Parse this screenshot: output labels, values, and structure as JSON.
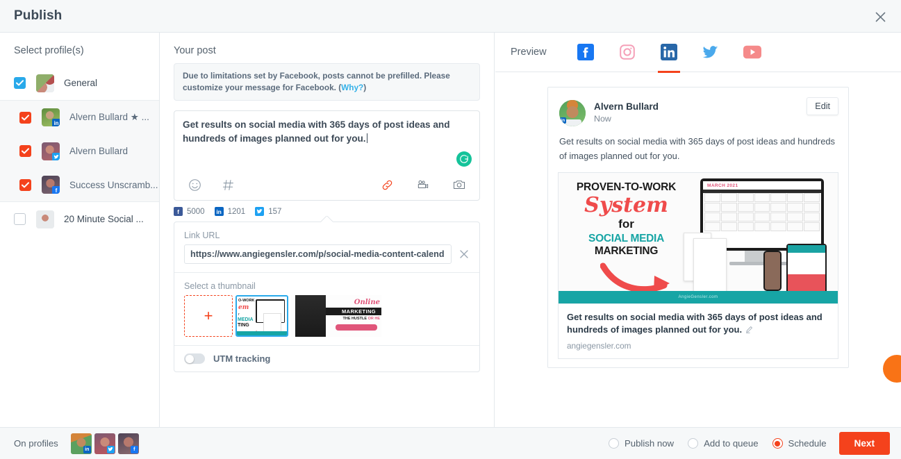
{
  "titlebar": {
    "title": "Publish",
    "close_icon": "close-icon"
  },
  "sidebar": {
    "heading": "Select profile(s)",
    "items": [
      {
        "label": "General",
        "checked": true,
        "accent": "#29a9ea",
        "network": "group",
        "star": false
      },
      {
        "label": "Alvern Bullard ★ ...",
        "checked": true,
        "accent": "#f4421c",
        "network": "linkedin",
        "badge": "in"
      },
      {
        "label": "Alvern Bullard",
        "checked": true,
        "accent": "#f4421c",
        "network": "twitter",
        "badge": "t"
      },
      {
        "label": "Success Unscramb...",
        "checked": true,
        "accent": "#f4421c",
        "network": "facebook",
        "badge": "f"
      },
      {
        "label": "20 Minute Social ...",
        "checked": false,
        "accent": "#ffffff",
        "network": "none",
        "badge": ""
      }
    ]
  },
  "composer": {
    "heading": "Your post",
    "notice_text": "Due to limitations set by Facebook, posts cannot be prefilled. Please customize your message for Facebook. (",
    "notice_link": "Why?",
    "notice_tail": ")",
    "post_text": "Get results on social media with 365 days of post ideas and hundreds of images planned out for you.",
    "grammarly_icon": "grammarly-icon",
    "toolbar_icons": [
      "emoji-icon",
      "hashtag-icon",
      "link-icon",
      "video-icon",
      "photo-icon"
    ],
    "counters": [
      {
        "network": "facebook",
        "value": "5000",
        "glyph": "f",
        "color": "#3b5998"
      },
      {
        "network": "linkedin",
        "value": "1201",
        "glyph": "in",
        "color": "#0a66c2"
      },
      {
        "network": "twitter",
        "value": "157",
        "glyph": "t",
        "color": "#1da1f2"
      }
    ]
  },
  "link_panel": {
    "url_label": "Link URL",
    "url_value": "https://www.angiegensler.com/p/social-media-content-calend",
    "clear_icon": "close-icon",
    "thumbnail_label": "Select a thumbnail",
    "add_thumbnail_icon": "plus-icon",
    "utm_label": "UTM tracking",
    "utm_enabled": false
  },
  "preview": {
    "heading": "Preview",
    "tabs": [
      {
        "name": "facebook",
        "label": "Facebook",
        "active": false,
        "color": "#1877f2"
      },
      {
        "name": "instagram",
        "label": "Instagram",
        "active": false,
        "color": "#f5a0b8"
      },
      {
        "name": "linkedin",
        "label": "LinkedIn",
        "active": true,
        "color": "#2867a8"
      },
      {
        "name": "twitter",
        "label": "Twitter",
        "active": false,
        "color": "#4aa9ec"
      },
      {
        "name": "youtube",
        "label": "YouTube",
        "active": false,
        "color": "#f58a8a"
      }
    ],
    "active_tab_accent": "#f4421c",
    "card": {
      "author": "Alvern Bullard",
      "timestamp": "Now",
      "edit_label": "Edit",
      "body": "Get results on social media with 365 days of post ideas and hundreds of images planned out for you.",
      "hero": {
        "line1": "PROVEN-TO-WORK",
        "line2": "System",
        "line3": "for",
        "line4": "SOCIAL MEDIA",
        "line5": "MARKETING",
        "footer": "AngieGensler.com",
        "calendar_title": "MARCH 2021"
      },
      "link_title": "Get results on social media with 365 days of post ideas and hundreds of images planned out for you.",
      "link_domain": "angiegensler.com",
      "edit_pencil_icon": "pencil-icon"
    }
  },
  "bottombar": {
    "on_profiles_label": "On profiles",
    "avatars": [
      {
        "badge": "in",
        "network": "linkedin"
      },
      {
        "badge": "t",
        "network": "twitter"
      },
      {
        "badge": "f",
        "network": "facebook"
      }
    ],
    "options": [
      {
        "label": "Publish now",
        "selected": false
      },
      {
        "label": "Add to queue",
        "selected": false
      },
      {
        "label": "Schedule",
        "selected": true
      }
    ],
    "next_label": "Next",
    "accent": "#f4421c"
  }
}
